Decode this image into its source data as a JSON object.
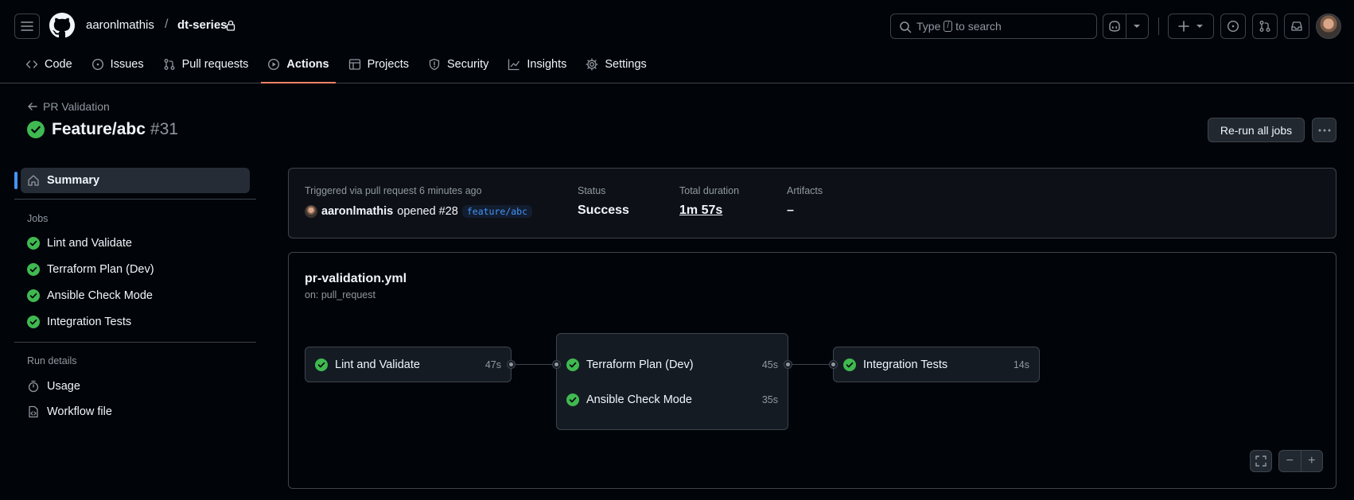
{
  "header": {
    "owner": "aaronlmathis",
    "separator": "/",
    "repo": "dt-series",
    "search_prefix": "Type",
    "search_key": "/",
    "search_suffix": "to search"
  },
  "tabs": [
    {
      "label": "Code"
    },
    {
      "label": "Issues"
    },
    {
      "label": "Pull requests"
    },
    {
      "label": "Actions",
      "active": true
    },
    {
      "label": "Projects"
    },
    {
      "label": "Security"
    },
    {
      "label": "Insights"
    },
    {
      "label": "Settings"
    }
  ],
  "run": {
    "back_label": "PR Validation",
    "title": "Feature/abc",
    "number": "#31",
    "rerun_label": "Re-run all jobs",
    "status_color": "#3fb950"
  },
  "sidebar": {
    "summary_label": "Summary",
    "jobs_heading": "Jobs",
    "jobs": [
      {
        "label": "Lint and Validate"
      },
      {
        "label": "Terraform Plan (Dev)"
      },
      {
        "label": "Ansible Check Mode"
      },
      {
        "label": "Integration Tests"
      }
    ],
    "run_details_heading": "Run details",
    "usage_label": "Usage",
    "workflow_file_label": "Workflow file"
  },
  "summary": {
    "triggered_label": "Triggered via pull request 6 minutes ago",
    "actor": "aaronlmathis",
    "action_text": "opened #28",
    "branch": "feature/abc",
    "status_label": "Status",
    "status_value": "Success",
    "duration_label": "Total duration",
    "duration_value": "1m 57s",
    "artifacts_label": "Artifacts",
    "artifacts_value": "–"
  },
  "graph": {
    "workflow_name": "pr-validation.yml",
    "trigger": "on: pull_request",
    "jobs": [
      {
        "label": "Lint and Validate",
        "time": "47s"
      },
      {
        "label": "Terraform Plan (Dev)",
        "time": "45s"
      },
      {
        "label": "Ansible Check Mode",
        "time": "35s"
      },
      {
        "label": "Integration Tests",
        "time": "14s"
      }
    ]
  }
}
